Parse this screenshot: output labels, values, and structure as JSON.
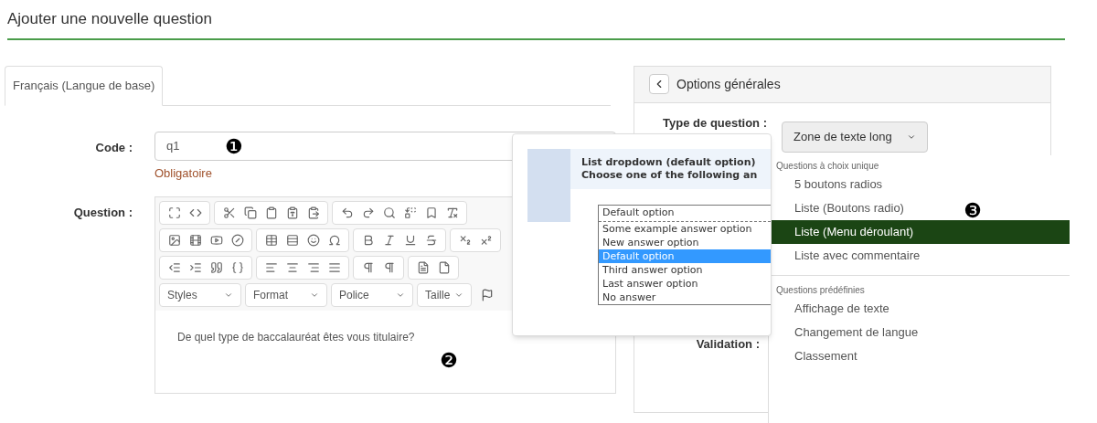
{
  "page_title": "Ajouter une nouvelle question",
  "tabs": [
    {
      "label": "Français (Langue de base)",
      "selected": true
    }
  ],
  "code_field": {
    "label": "Code :",
    "value": "q1",
    "error": "Obligatoire"
  },
  "question_field": {
    "label": "Question :",
    "toolbar_dropdowns": [
      "Styles",
      "Format",
      "Police",
      "Taille"
    ],
    "value": "De quel type de baccalauréat êtes vous titulaire?"
  },
  "callouts": [
    "❶",
    "❷",
    "❸"
  ],
  "options_panel": {
    "title": "Options générales",
    "type_label": "Type de question :",
    "type_button": "Zone de texte long",
    "validation_label": "Validation :"
  },
  "type_menu": {
    "groups": [
      {
        "heading": "Questions à choix unique",
        "items": [
          {
            "label": "5 boutons radios",
            "selected": false
          },
          {
            "label": "Liste (Boutons radio)",
            "selected": false
          },
          {
            "label": "Liste (Menu déroulant)",
            "selected": true
          },
          {
            "label": "Liste avec commentaire",
            "selected": false
          }
        ]
      },
      {
        "heading": "Questions prédéfinies",
        "items": [
          {
            "label": "Affichage de texte",
            "selected": false
          },
          {
            "label": "Changement de langue",
            "selected": false
          },
          {
            "label": "Classement",
            "selected": false
          }
        ]
      }
    ]
  },
  "preview": {
    "title": "List dropdown (default option)",
    "subtitle": "Choose one of the following an",
    "select_value": "Default option",
    "options": [
      {
        "label": "Some example answer option",
        "selected": false
      },
      {
        "label": "New answer option",
        "selected": false
      },
      {
        "label": "Default option",
        "selected": true
      },
      {
        "label": "Third answer option",
        "selected": false
      },
      {
        "label": "Last answer option",
        "selected": false
      },
      {
        "label": "No answer",
        "selected": false
      }
    ]
  }
}
